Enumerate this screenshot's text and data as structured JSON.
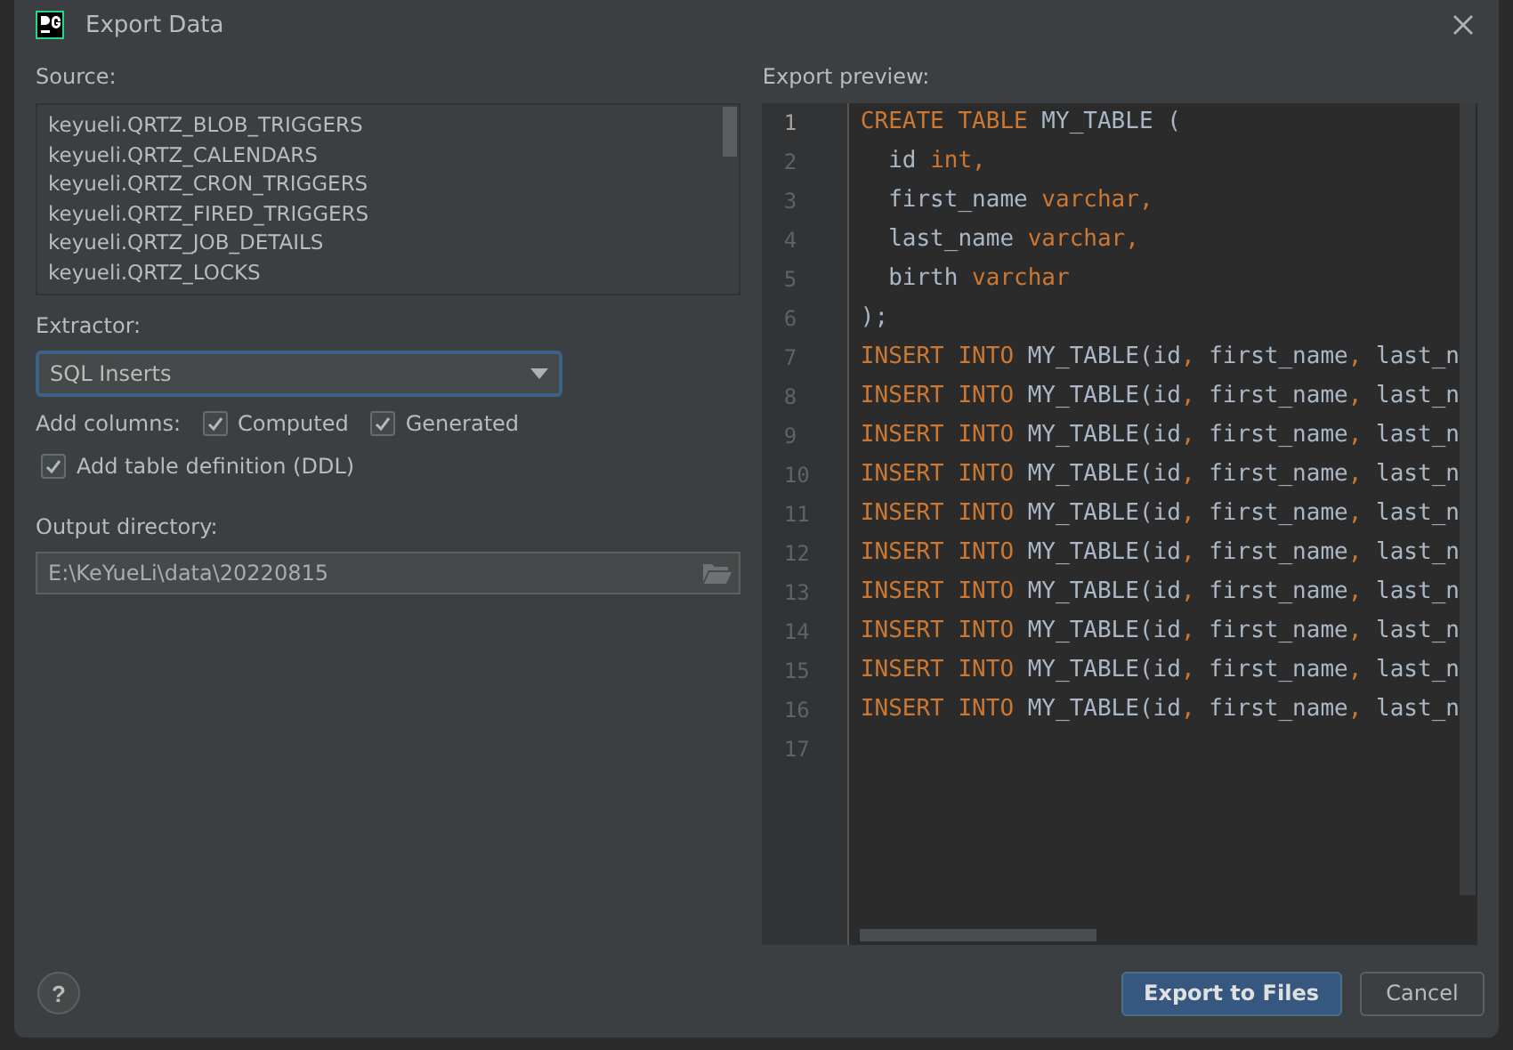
{
  "window": {
    "title": "Export Data"
  },
  "source": {
    "label": "Source:",
    "items": [
      "keyueli.QRTZ_BLOB_TRIGGERS",
      "keyueli.QRTZ_CALENDARS",
      "keyueli.QRTZ_CRON_TRIGGERS",
      "keyueli.QRTZ_FIRED_TRIGGERS",
      "keyueli.QRTZ_JOB_DETAILS",
      "keyueli.QRTZ_LOCKS"
    ]
  },
  "extractor": {
    "label": "Extractor:",
    "value": "SQL Inserts"
  },
  "add_columns": {
    "label": "Add columns:",
    "options": [
      {
        "label": "Computed",
        "checked": true
      },
      {
        "label": "Generated",
        "checked": true
      }
    ]
  },
  "ddl": {
    "label": "Add table definition (DDL)",
    "checked": true
  },
  "output_directory": {
    "label": "Output directory:",
    "value": "E:\\KeYueLi\\data\\20220815"
  },
  "preview": {
    "label": "Export preview:",
    "lines": [
      {
        "number": "1",
        "current": true,
        "tokens": [
          {
            "kind": "keyword",
            "text": "CREATE TABLE "
          },
          {
            "kind": "ident",
            "text": "MY_TABLE ("
          }
        ]
      },
      {
        "number": "2",
        "current": false,
        "tokens": [
          {
            "kind": "ident",
            "text": "  id "
          },
          {
            "kind": "keyword",
            "text": "int,"
          }
        ]
      },
      {
        "number": "3",
        "current": false,
        "tokens": [
          {
            "kind": "ident",
            "text": "  first_name "
          },
          {
            "kind": "keyword",
            "text": "varchar,"
          }
        ]
      },
      {
        "number": "4",
        "current": false,
        "tokens": [
          {
            "kind": "ident",
            "text": "  last_name "
          },
          {
            "kind": "keyword",
            "text": "varchar,"
          }
        ]
      },
      {
        "number": "5",
        "current": false,
        "tokens": [
          {
            "kind": "ident",
            "text": "  birth "
          },
          {
            "kind": "keyword",
            "text": "varchar"
          }
        ]
      },
      {
        "number": "6",
        "current": false,
        "tokens": [
          {
            "kind": "ident",
            "text": ");"
          }
        ]
      },
      {
        "number": "7",
        "current": false,
        "tokens": [
          {
            "kind": "keyword",
            "text": "INSERT INTO "
          },
          {
            "kind": "ident",
            "text": "MY_TABLE(id"
          },
          {
            "kind": "keyword",
            "text": ", "
          },
          {
            "kind": "ident",
            "text": "first_name"
          },
          {
            "kind": "keyword",
            "text": ", "
          },
          {
            "kind": "ident",
            "text": "last_n"
          }
        ]
      },
      {
        "number": "8",
        "current": false,
        "tokens": [
          {
            "kind": "keyword",
            "text": "INSERT INTO "
          },
          {
            "kind": "ident",
            "text": "MY_TABLE(id"
          },
          {
            "kind": "keyword",
            "text": ", "
          },
          {
            "kind": "ident",
            "text": "first_name"
          },
          {
            "kind": "keyword",
            "text": ", "
          },
          {
            "kind": "ident",
            "text": "last_n"
          }
        ]
      },
      {
        "number": "9",
        "current": false,
        "tokens": [
          {
            "kind": "keyword",
            "text": "INSERT INTO "
          },
          {
            "kind": "ident",
            "text": "MY_TABLE(id"
          },
          {
            "kind": "keyword",
            "text": ", "
          },
          {
            "kind": "ident",
            "text": "first_name"
          },
          {
            "kind": "keyword",
            "text": ", "
          },
          {
            "kind": "ident",
            "text": "last_n"
          }
        ]
      },
      {
        "number": "10",
        "current": false,
        "tokens": [
          {
            "kind": "keyword",
            "text": "INSERT INTO "
          },
          {
            "kind": "ident",
            "text": "MY_TABLE(id"
          },
          {
            "kind": "keyword",
            "text": ", "
          },
          {
            "kind": "ident",
            "text": "first_name"
          },
          {
            "kind": "keyword",
            "text": ", "
          },
          {
            "kind": "ident",
            "text": "last_n"
          }
        ]
      },
      {
        "number": "11",
        "current": false,
        "tokens": [
          {
            "kind": "keyword",
            "text": "INSERT INTO "
          },
          {
            "kind": "ident",
            "text": "MY_TABLE(id"
          },
          {
            "kind": "keyword",
            "text": ", "
          },
          {
            "kind": "ident",
            "text": "first_name"
          },
          {
            "kind": "keyword",
            "text": ", "
          },
          {
            "kind": "ident",
            "text": "last_n"
          }
        ]
      },
      {
        "number": "12",
        "current": false,
        "tokens": [
          {
            "kind": "keyword",
            "text": "INSERT INTO "
          },
          {
            "kind": "ident",
            "text": "MY_TABLE(id"
          },
          {
            "kind": "keyword",
            "text": ", "
          },
          {
            "kind": "ident",
            "text": "first_name"
          },
          {
            "kind": "keyword",
            "text": ", "
          },
          {
            "kind": "ident",
            "text": "last_n"
          }
        ]
      },
      {
        "number": "13",
        "current": false,
        "tokens": [
          {
            "kind": "keyword",
            "text": "INSERT INTO "
          },
          {
            "kind": "ident",
            "text": "MY_TABLE(id"
          },
          {
            "kind": "keyword",
            "text": ", "
          },
          {
            "kind": "ident",
            "text": "first_name"
          },
          {
            "kind": "keyword",
            "text": ", "
          },
          {
            "kind": "ident",
            "text": "last_n"
          }
        ]
      },
      {
        "number": "14",
        "current": false,
        "tokens": [
          {
            "kind": "keyword",
            "text": "INSERT INTO "
          },
          {
            "kind": "ident",
            "text": "MY_TABLE(id"
          },
          {
            "kind": "keyword",
            "text": ", "
          },
          {
            "kind": "ident",
            "text": "first_name"
          },
          {
            "kind": "keyword",
            "text": ", "
          },
          {
            "kind": "ident",
            "text": "last_n"
          }
        ]
      },
      {
        "number": "15",
        "current": false,
        "tokens": [
          {
            "kind": "keyword",
            "text": "INSERT INTO "
          },
          {
            "kind": "ident",
            "text": "MY_TABLE(id"
          },
          {
            "kind": "keyword",
            "text": ", "
          },
          {
            "kind": "ident",
            "text": "first_name"
          },
          {
            "kind": "keyword",
            "text": ", "
          },
          {
            "kind": "ident",
            "text": "last_n"
          }
        ]
      },
      {
        "number": "16",
        "current": false,
        "tokens": [
          {
            "kind": "keyword",
            "text": "INSERT INTO "
          },
          {
            "kind": "ident",
            "text": "MY_TABLE(id"
          },
          {
            "kind": "keyword",
            "text": ", "
          },
          {
            "kind": "ident",
            "text": "first_name"
          },
          {
            "kind": "keyword",
            "text": ", "
          },
          {
            "kind": "ident",
            "text": "last_n"
          }
        ]
      },
      {
        "number": "17",
        "current": false
      }
    ]
  },
  "help_button": {
    "label": "?"
  },
  "buttons": [
    {
      "label": "Export to Files",
      "kind": "primary"
    },
    {
      "label": "Cancel",
      "kind": "secondary"
    }
  ]
}
